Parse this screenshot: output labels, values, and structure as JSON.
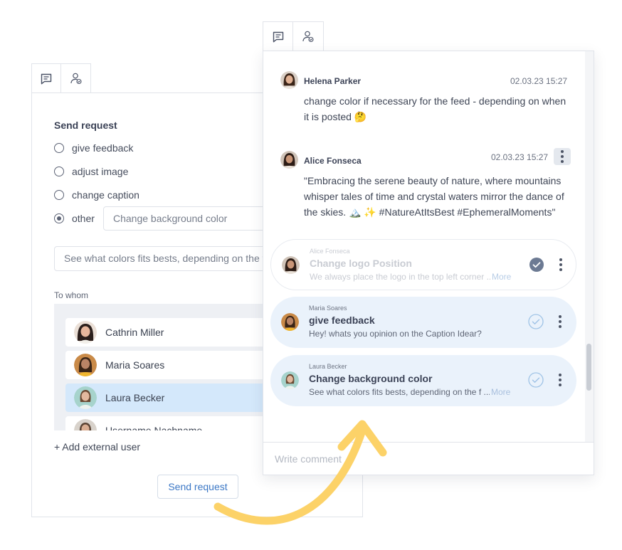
{
  "colors": {
    "accent": "#3c78c6",
    "selected_row": "#d4e8fb",
    "request_card": "#eaf2fb",
    "arrow": "#fcd268",
    "check": "#6c7a93"
  },
  "left_panel": {
    "tabs": [
      {
        "icon": "comment-icon"
      },
      {
        "icon": "user-check-icon"
      }
    ],
    "heading": "Send request",
    "options": [
      {
        "label": "give feedback",
        "checked": false
      },
      {
        "label": "adjust image",
        "checked": false
      },
      {
        "label": "change caption",
        "checked": false
      },
      {
        "label": "other",
        "checked": true
      }
    ],
    "other_value": "Change background color",
    "description_value": "See what colors fits bests, depending on the f",
    "to_whom_label": "To whom",
    "users": [
      {
        "name": "Cathrin Miller",
        "selected": false
      },
      {
        "name": "Maria Soares",
        "selected": false
      },
      {
        "name": "Laura Becker",
        "selected": true
      },
      {
        "name": "Username Nachname",
        "selected": false
      }
    ],
    "add_external": "+ Add external user",
    "send_button": "Send request"
  },
  "right_panel": {
    "tabs": [
      {
        "icon": "comment-icon"
      },
      {
        "icon": "user-check-icon"
      }
    ],
    "comments": [
      {
        "author": "Helena Parker",
        "date": "02.03.23 15:27",
        "text_line1": "change color if necessary for the feed - depending on when",
        "text_line2": "it is posted 🤔"
      },
      {
        "author": "Alice Fonseca",
        "date": "02.03.23 15:27",
        "text_line1": "\"Embracing the serene beauty of nature, where mountains",
        "text_line2": "whisper tales of time and crystal waters mirror the dance of",
        "text_line3": "the skies. 🏔️ ✨ #NatureAtItsBest #EphemeralMoments\""
      }
    ],
    "requests": [
      {
        "from": "Alice Fonseca",
        "title": "Change logo Position",
        "description": "We always place the logo in the top left corner ...",
        "more": "More",
        "status": "completed"
      },
      {
        "from": "Maria Soares",
        "title": "give feedback",
        "description": "Hey! whats you opinion on the Caption Idear?",
        "status": "open"
      },
      {
        "from": "Laura Becker",
        "title": "Change background color",
        "description": "See what colors fits bests, depending on the f ...",
        "more": "More",
        "status": "open"
      }
    ],
    "comment_placeholder": "Write comment"
  }
}
